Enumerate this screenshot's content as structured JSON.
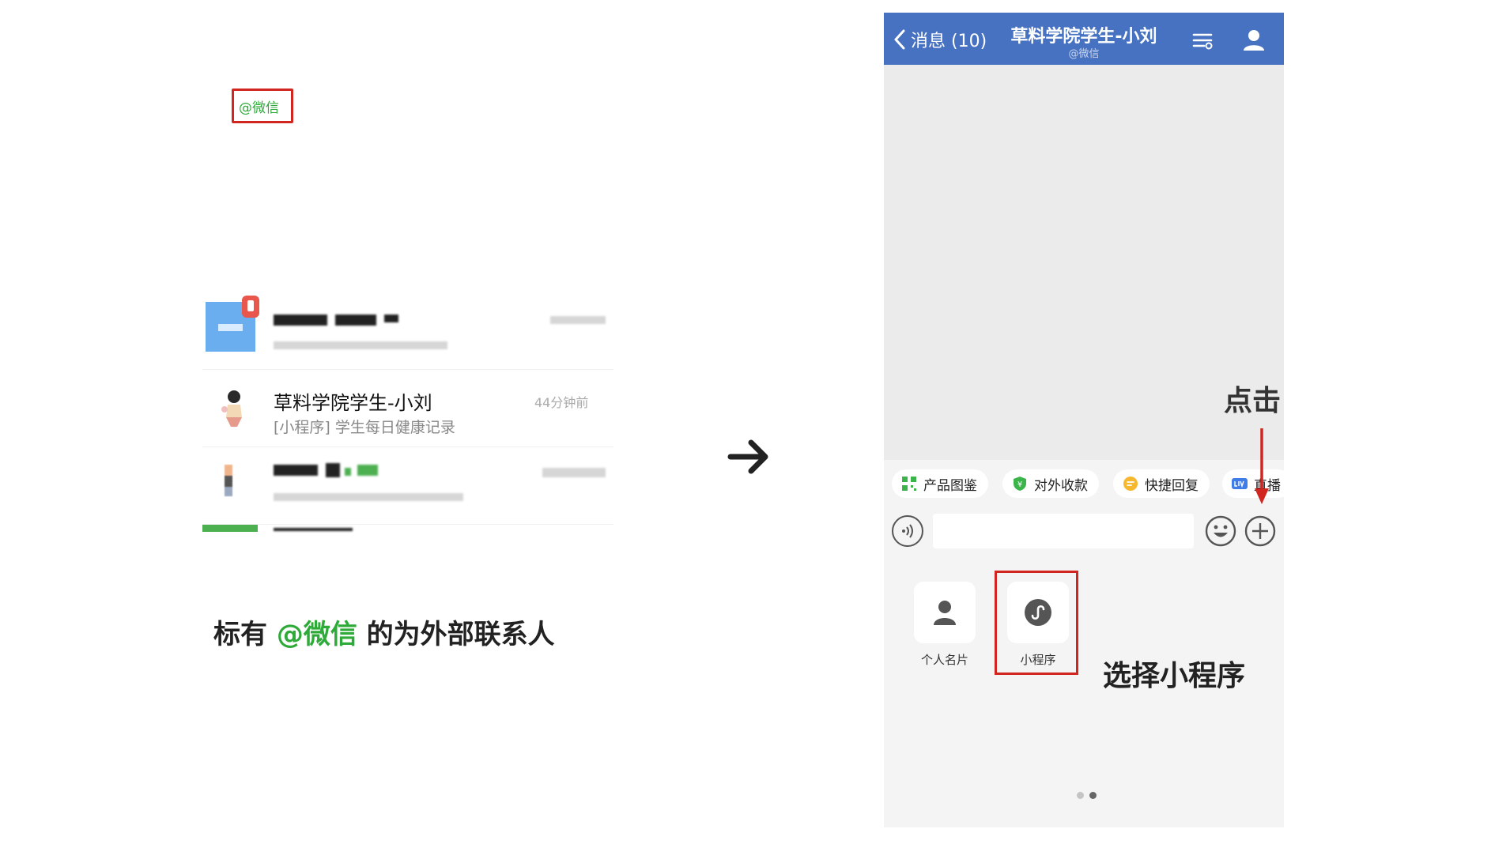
{
  "left": {
    "rows": [
      {
        "name": "",
        "preview": "",
        "time": ""
      },
      {
        "name": "草料学院学生-小刘",
        "tag": "@微信",
        "time": "44分钟前",
        "preview": "[小程序] 学生每日健康记录"
      },
      {
        "name": "",
        "preview": "",
        "time": ""
      }
    ],
    "caption_prefix": "标有 ",
    "caption_highlight": "@微信",
    "caption_suffix": " 的为外部联系人"
  },
  "phone": {
    "nav": {
      "back_label": "消息 (10)",
      "title": "草料学院学生-小刘",
      "subtitle": "@微信"
    },
    "quick_actions": [
      {
        "label": "产品图鉴",
        "icon": "grid-icon"
      },
      {
        "label": "对外收款",
        "icon": "shield-yen-icon"
      },
      {
        "label": "快捷回复",
        "icon": "chat-bubble-icon"
      },
      {
        "label": "直播",
        "icon": "live-icon"
      }
    ],
    "panel_items": [
      {
        "label": "个人名片",
        "icon": "person-icon"
      },
      {
        "label": "小程序",
        "icon": "mini-program-icon"
      }
    ]
  },
  "annotations": {
    "click": "点击",
    "select": "选择小程序"
  },
  "colors": {
    "nav_blue": "#4772c1",
    "highlight_green": "#2eaa39",
    "annotation_red": "#d1261f"
  }
}
